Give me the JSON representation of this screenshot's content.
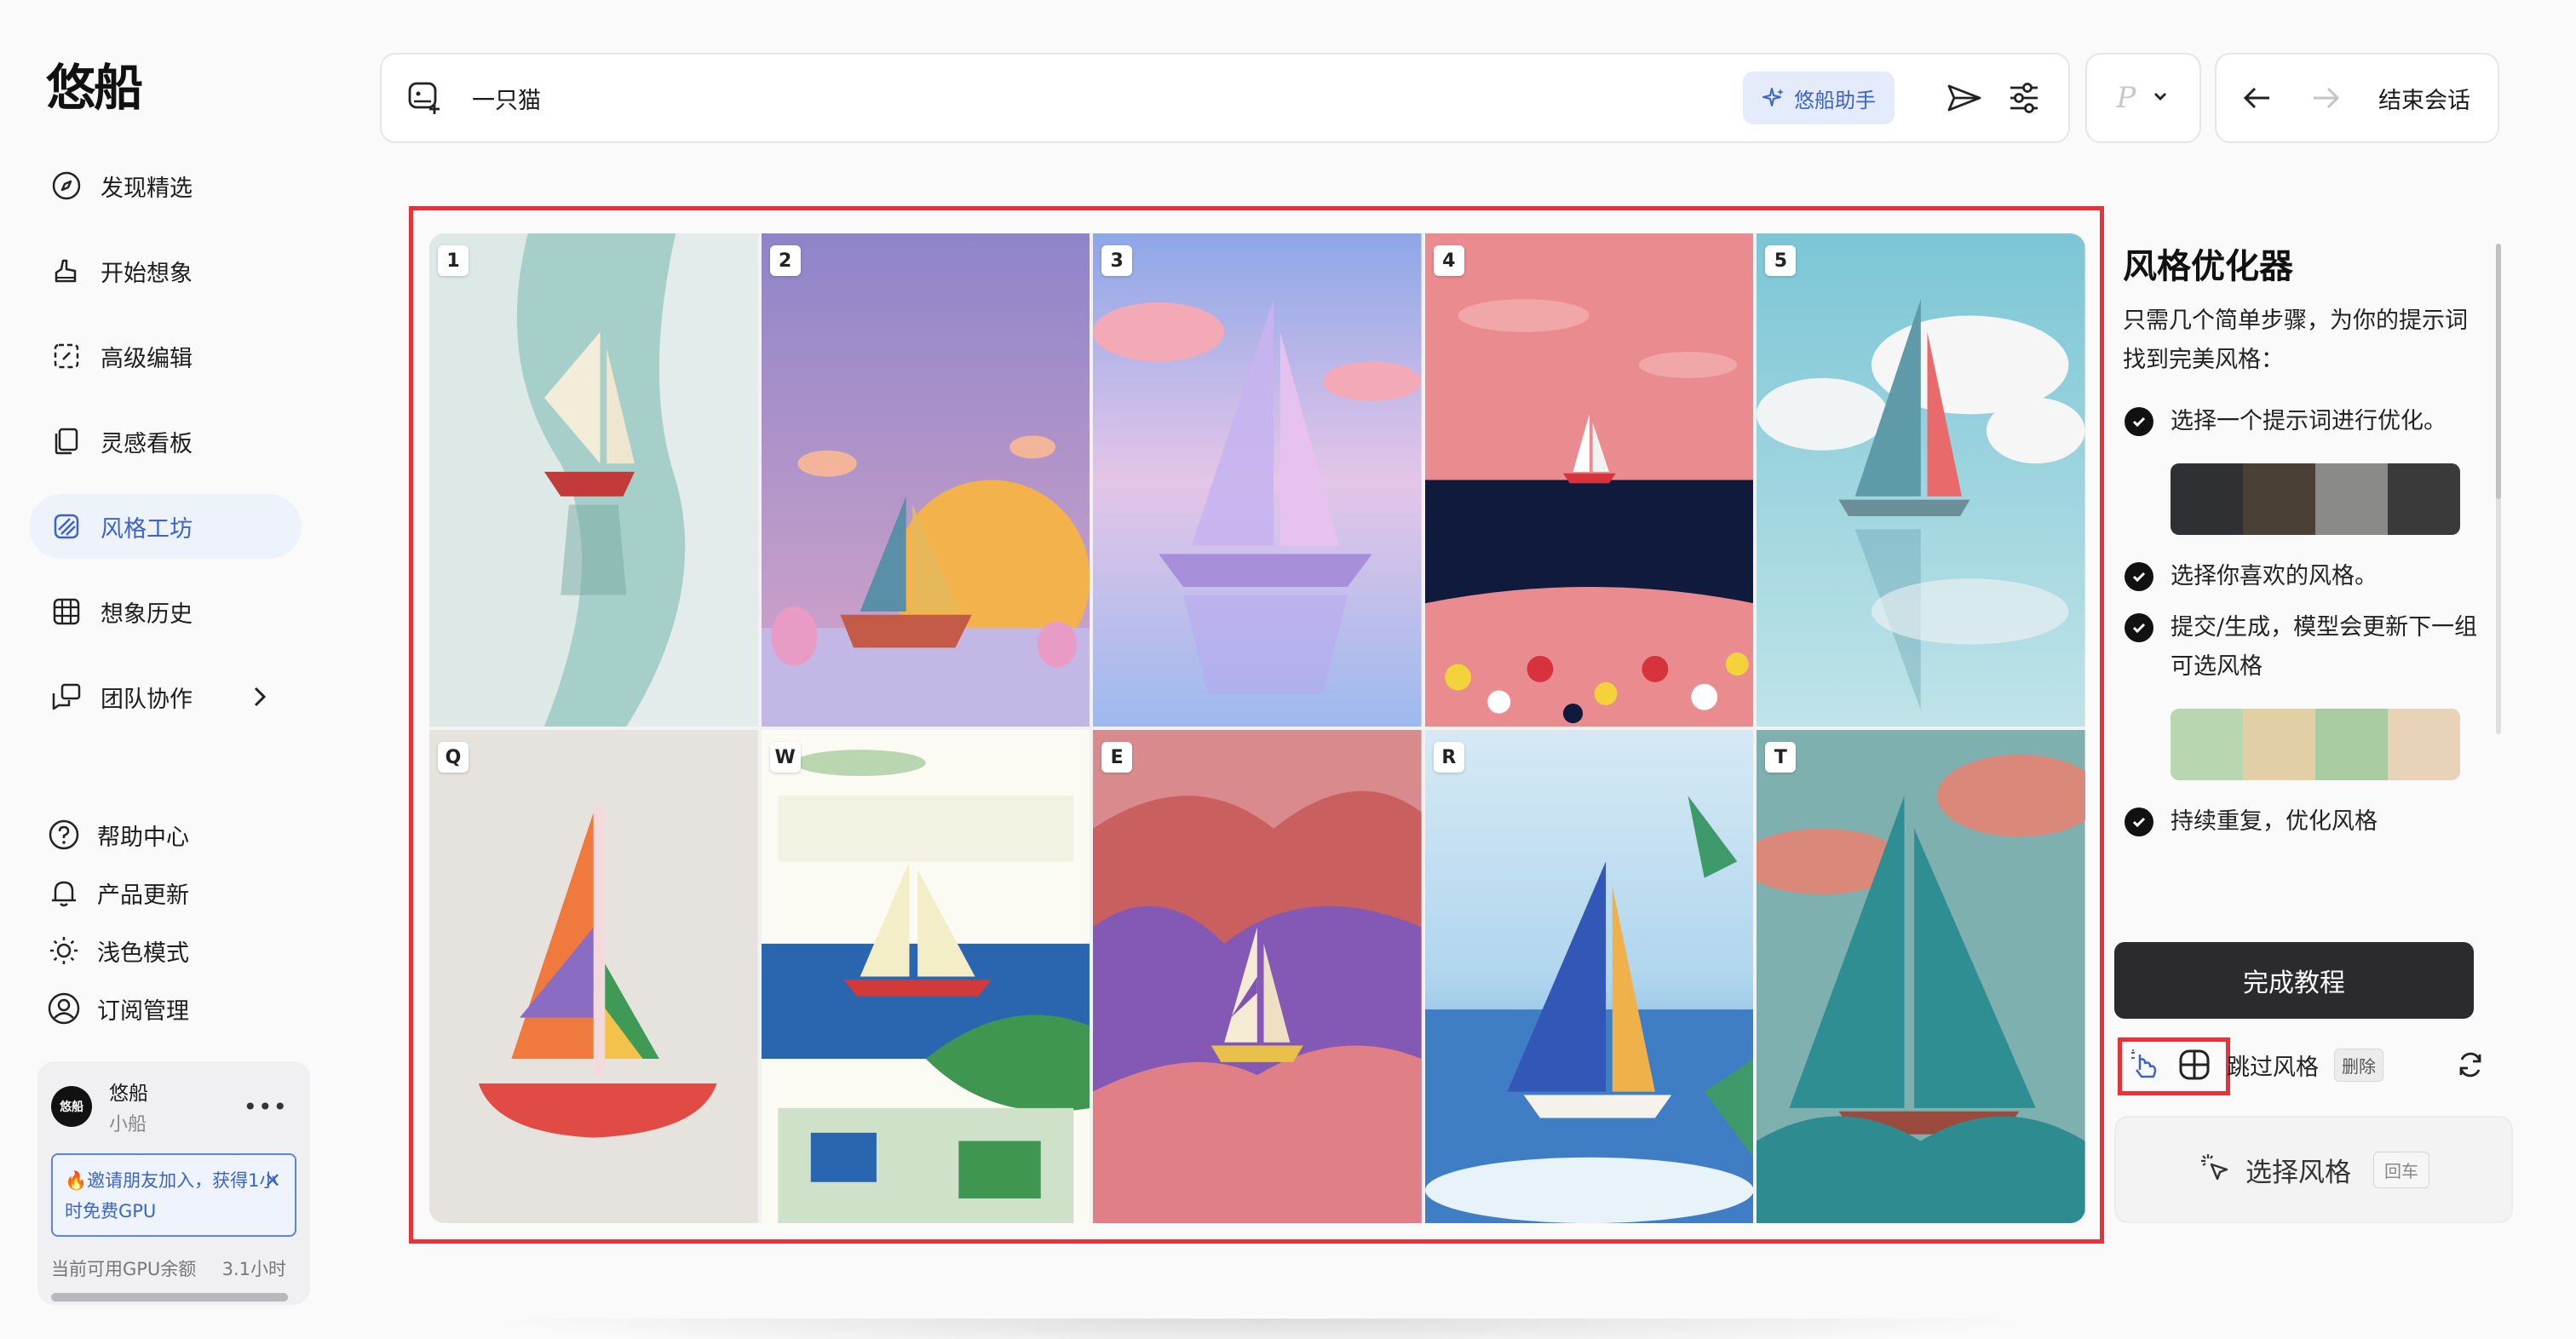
{
  "app": {
    "logo": "悠船"
  },
  "sidebar": {
    "items": [
      {
        "label": "发现精选",
        "icon": "compass-icon"
      },
      {
        "label": "开始想象",
        "icon": "hand-brush-icon"
      },
      {
        "label": "高级编辑",
        "icon": "edit-frame-icon"
      },
      {
        "label": "灵感看板",
        "icon": "cards-icon"
      },
      {
        "label": "风格工坊",
        "icon": "style-icon",
        "active": true
      },
      {
        "label": "想象历史",
        "icon": "grid-icon"
      },
      {
        "label": "团队协作",
        "icon": "team-icon"
      }
    ],
    "secondary": [
      {
        "label": "帮助中心",
        "icon": "help-icon"
      },
      {
        "label": "产品更新",
        "icon": "bell-icon"
      },
      {
        "label": "浅色模式",
        "icon": "sun-icon"
      },
      {
        "label": "订阅管理",
        "icon": "user-circle-icon"
      }
    ]
  },
  "user": {
    "avatar_text": "悠船",
    "name": "悠船",
    "sub": "小船",
    "invite_text": "🔥邀请朋友加入，获得1小时免费GPU",
    "gpu_label": "当前可用GPU余额",
    "gpu_value": "3.1小时",
    "gpu_fraction": 1.0
  },
  "topbar": {
    "prompt": "一只猫",
    "assistant_label": "悠船助手",
    "p_label": "P",
    "end_label": "结束会话"
  },
  "grid": {
    "tiles": [
      {
        "label": "1"
      },
      {
        "label": "2"
      },
      {
        "label": "3"
      },
      {
        "label": "4"
      },
      {
        "label": "5"
      },
      {
        "label": "Q"
      },
      {
        "label": "W"
      },
      {
        "label": "E"
      },
      {
        "label": "R"
      },
      {
        "label": "T"
      }
    ]
  },
  "panel": {
    "title": "风格优化器",
    "desc": "只需几个简单步骤，为你的提示词找到完美风格：",
    "steps": [
      "选择一个提示词进行优化。",
      "选择你喜欢的风格。",
      "提交/生成，模型会更新下一组可选风格",
      "持续重复，优化风格"
    ],
    "finish_label": "完成教程",
    "skip_label": "跳过风格",
    "delete_label": "删除",
    "select_label": "选择风格",
    "enter_label": "回车"
  },
  "colors": {
    "accent": "#3b63c9",
    "highlight": "#e8323a",
    "dark_button": "#2b2b2e"
  }
}
